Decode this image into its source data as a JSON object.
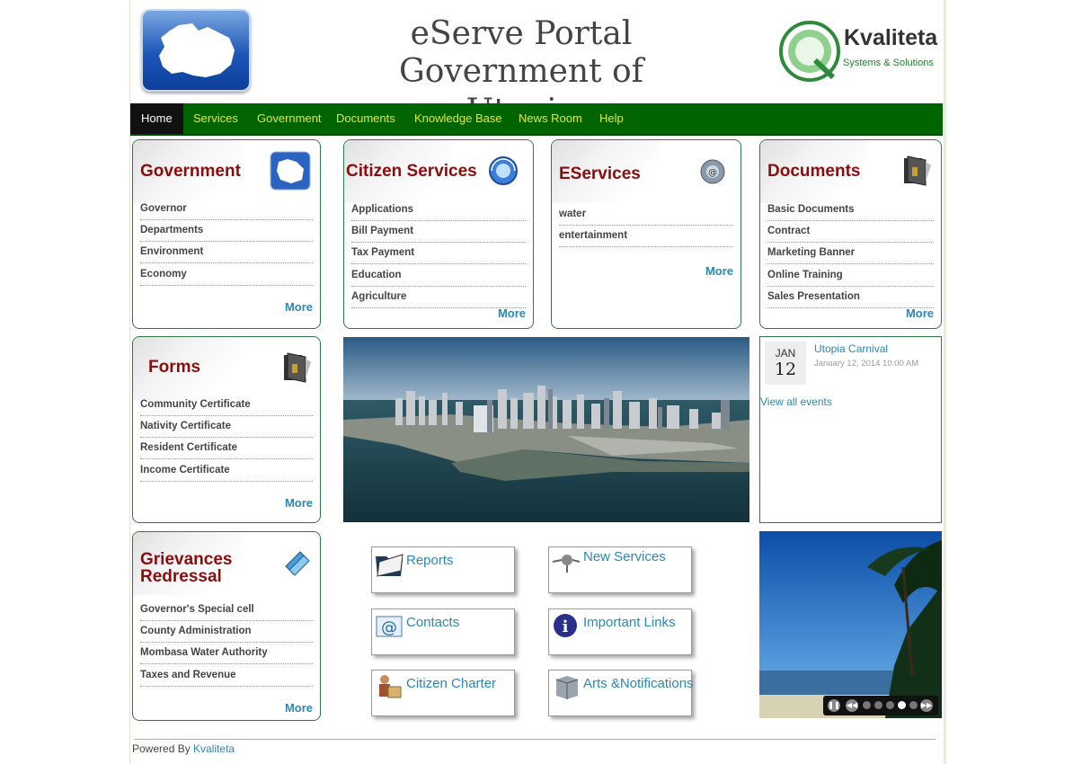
{
  "header": {
    "title_line1": "eServe Portal",
    "title_line2": "Government of Utopia",
    "logo_name": "Kvaliteta",
    "logo_tagline": "Systems & Solutions",
    "logo_letter": "Q"
  },
  "nav": {
    "items": [
      "Home",
      "Services",
      "Government",
      "Documents",
      "Knowledge Base",
      "News Room",
      "Help"
    ],
    "active": "Home"
  },
  "boxes": {
    "government": {
      "title": "Government",
      "items": [
        "Governor",
        "Departments",
        "Environment",
        "Economy"
      ],
      "more": "More"
    },
    "citizen": {
      "title": "Citizen Services",
      "items": [
        "Applications",
        "Bill Payment",
        "Tax Payment",
        "Education",
        "Agriculture"
      ],
      "more": "More"
    },
    "eservices": {
      "title": "EServices",
      "items": [
        "water",
        "entertainment"
      ],
      "more": "More"
    },
    "documents": {
      "title": "Documents",
      "items": [
        "Basic Documents",
        "Contract",
        "Marketing Banner",
        "Online Training",
        "Sales Presentation"
      ],
      "more": "More"
    },
    "forms": {
      "title": "Forms",
      "items": [
        "Community Certificate",
        "Nativity Certificate",
        "Resident Certificate",
        "Income Certificate"
      ],
      "more": "More"
    },
    "grievances": {
      "title_line1": "Grievances",
      "title_line2": "Redressal",
      "items": [
        "Governor's Special cell",
        "County Administration",
        "Mombasa Water Authority",
        "Taxes and Revenue"
      ],
      "more": "More"
    }
  },
  "events": {
    "month": "JAN",
    "day": "12",
    "title": "Utopia Carnival",
    "time": "January 12, 2014 10:00 AM",
    "view_all": "View all events"
  },
  "quick_links": {
    "reports": "Reports",
    "new_services": "New Services",
    "contacts": "Contacts",
    "important_links": "Important Links",
    "citizen_charter": "Citizen Charter",
    "arts_notifications": "Arts &Notifications"
  },
  "slider": {
    "slide_count": 5,
    "active_slide": 4
  },
  "footer": {
    "prefix": "Powered By ",
    "link": "Kvaliteta"
  },
  "colors": {
    "nav_bg": "#006400",
    "nav_text": "#e6e633",
    "box_title": "#8b0d0d",
    "link": "#2a87b8",
    "box_border": "#2e7a45"
  }
}
